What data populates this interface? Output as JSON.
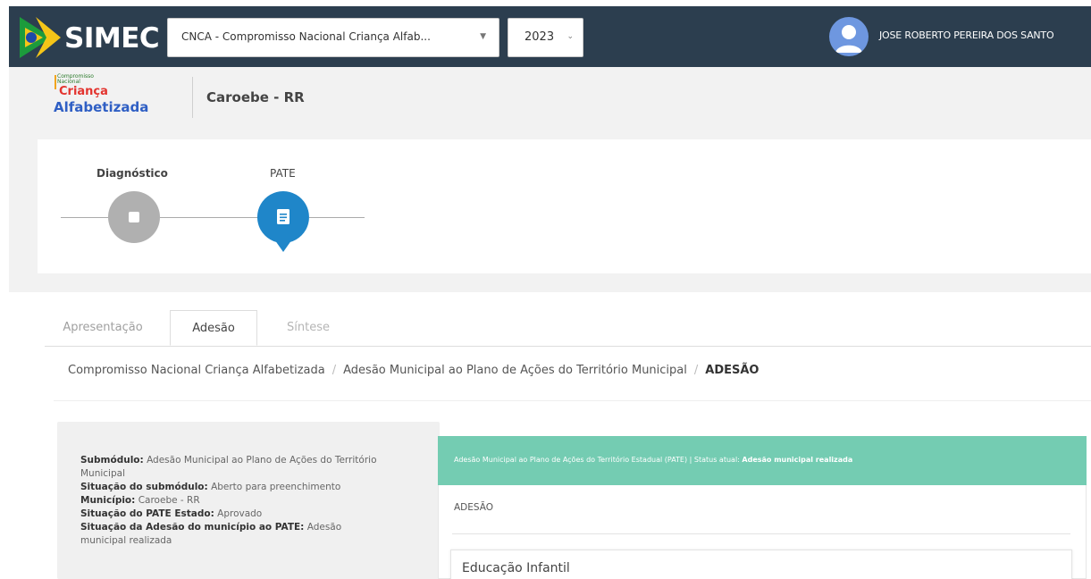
{
  "topbar": {
    "app_name": "SIMEC",
    "system_select": {
      "value": "CNCA - Compromisso Nacional Criança Alfab...",
      "caret": "▼"
    },
    "year_select": {
      "value": "2023",
      "caret": "⌄"
    },
    "user_name": "JOSE ROBERTO PEREIRA DOS SANTO",
    "avatar_icon": "user-avatar-icon"
  },
  "brand": {
    "line1": "Compromisso",
    "line2": "Nacional",
    "crianca": "Criança",
    "alfabetizada": "Alfabetizada"
  },
  "header": {
    "city": "Caroebe - RR"
  },
  "stepper": {
    "steps": [
      {
        "label": "Diagnóstico",
        "state": "inactive",
        "color": "#b0b0b0"
      },
      {
        "label": "PATE",
        "state": "active",
        "color": "#1f86c9"
      }
    ]
  },
  "tabs": [
    {
      "label": "Apresentação",
      "active": false
    },
    {
      "label": "Adesão",
      "active": true
    },
    {
      "label": "Síntese",
      "active": false
    }
  ],
  "breadcrumb": {
    "items": [
      "Compromisso Nacional Criança Alfabetizada",
      "Adesão Municipal ao Plano de Ações do Território Municipal"
    ],
    "separator": "/",
    "current": "ADESÃO"
  },
  "info": {
    "submodulo_label": "Submódulo:",
    "submodulo_value": "Adesão Municipal ao Plano de Ações do Território Municipal",
    "situacao_sub_label": "Situação do submódulo:",
    "situacao_sub_value": "Aberto para preenchimento",
    "municipio_label": "Município:",
    "municipio_value": "Caroebe - RR",
    "pate_estado_label": "Situação do PATE Estado:",
    "pate_estado_value": "Aprovado",
    "adesao_mun_label": "Situação da Adesão do município ao PATE:",
    "adesao_mun_value": "Adesão municipal realizada"
  },
  "status_panel": {
    "title": "Adesão Municipal ao Plano de Ações do Território Estadual (PATE) |",
    "status_label": "Status atual:",
    "status_value": "Adesão municipal realizada",
    "header_color": "#74ccb2",
    "section_label": "ADESÃO",
    "card_title": "Educação Infantil"
  }
}
